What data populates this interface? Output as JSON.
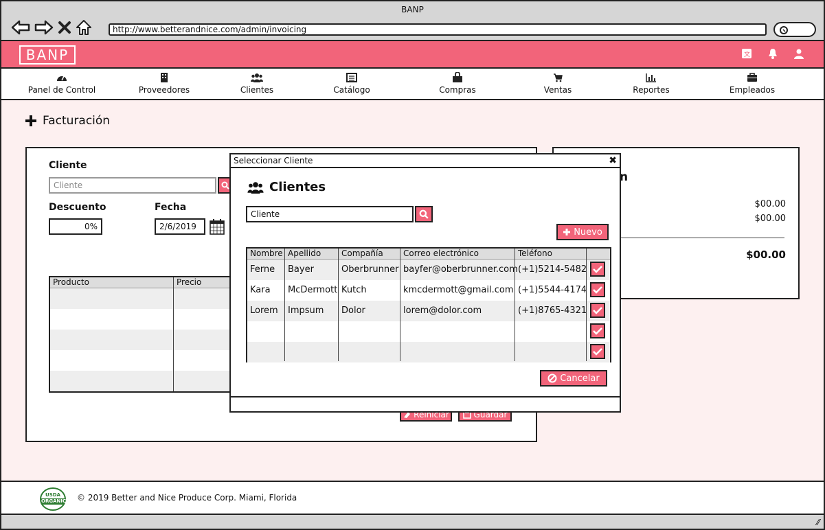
{
  "browser": {
    "title": "BANP",
    "url": "http://www.betterandnice.com/admin/invoicing"
  },
  "app": {
    "logo": "BANP",
    "brand_color": "#f2647a"
  },
  "nav": [
    {
      "label": "Panel de Control",
      "icon": "dashboard-icon"
    },
    {
      "label": "Proveedores",
      "icon": "building-icon"
    },
    {
      "label": "Clientes",
      "icon": "users-icon"
    },
    {
      "label": "Catálogo",
      "icon": "list-icon"
    },
    {
      "label": "Compras",
      "icon": "shopping-bag-icon"
    },
    {
      "label": "Ventas",
      "icon": "cart-icon"
    },
    {
      "label": "Reportes",
      "icon": "bar-chart-icon"
    },
    {
      "label": "Empleados",
      "icon": "briefcase-icon"
    }
  ],
  "page": {
    "title": "Facturación"
  },
  "invoice": {
    "client_label": "Cliente",
    "client_placeholder": "Cliente",
    "discount_label": "Descuento",
    "discount_value": "0%",
    "date_label": "Fecha",
    "date_value": "2/6/2019",
    "columns": [
      "Producto",
      "Precio"
    ],
    "reset_label": "Reiniciar",
    "save_label": "Guardar"
  },
  "summary": {
    "title_fragment": "n",
    "line1": "$00.00",
    "line2": "$00.00",
    "total": "$00.00"
  },
  "modal": {
    "title": "Seleccionar Cliente",
    "heading": "Clientes",
    "search_value": "Cliente",
    "new_label": "Nuevo",
    "cancel_label": "Cancelar",
    "columns": [
      "Nombre",
      "Apellido",
      "Compañía",
      "Correo electrónico",
      "Teléfono"
    ],
    "rows": [
      [
        "Ferne",
        "Bayer",
        "Oberbrunner",
        "bayfer@oberbrunner.com",
        "(+1)5214-5482"
      ],
      [
        "Kara",
        "McDermott",
        "Kutch",
        "kmcdermott@gmail.com",
        "(+1)5544-4174"
      ],
      [
        "Lorem",
        "Impsum",
        "Dolor",
        "lorem@dolor.com",
        "(+1)8765-4321"
      ],
      [
        "",
        "",
        "",
        "",
        ""
      ],
      [
        "",
        "",
        "",
        "",
        ""
      ]
    ]
  },
  "footer": {
    "usda_top": "USDA",
    "usda_bottom": "ORGANIC",
    "copyright": "© 2019 Better and Nice Produce Corp. Miami, Florida"
  }
}
